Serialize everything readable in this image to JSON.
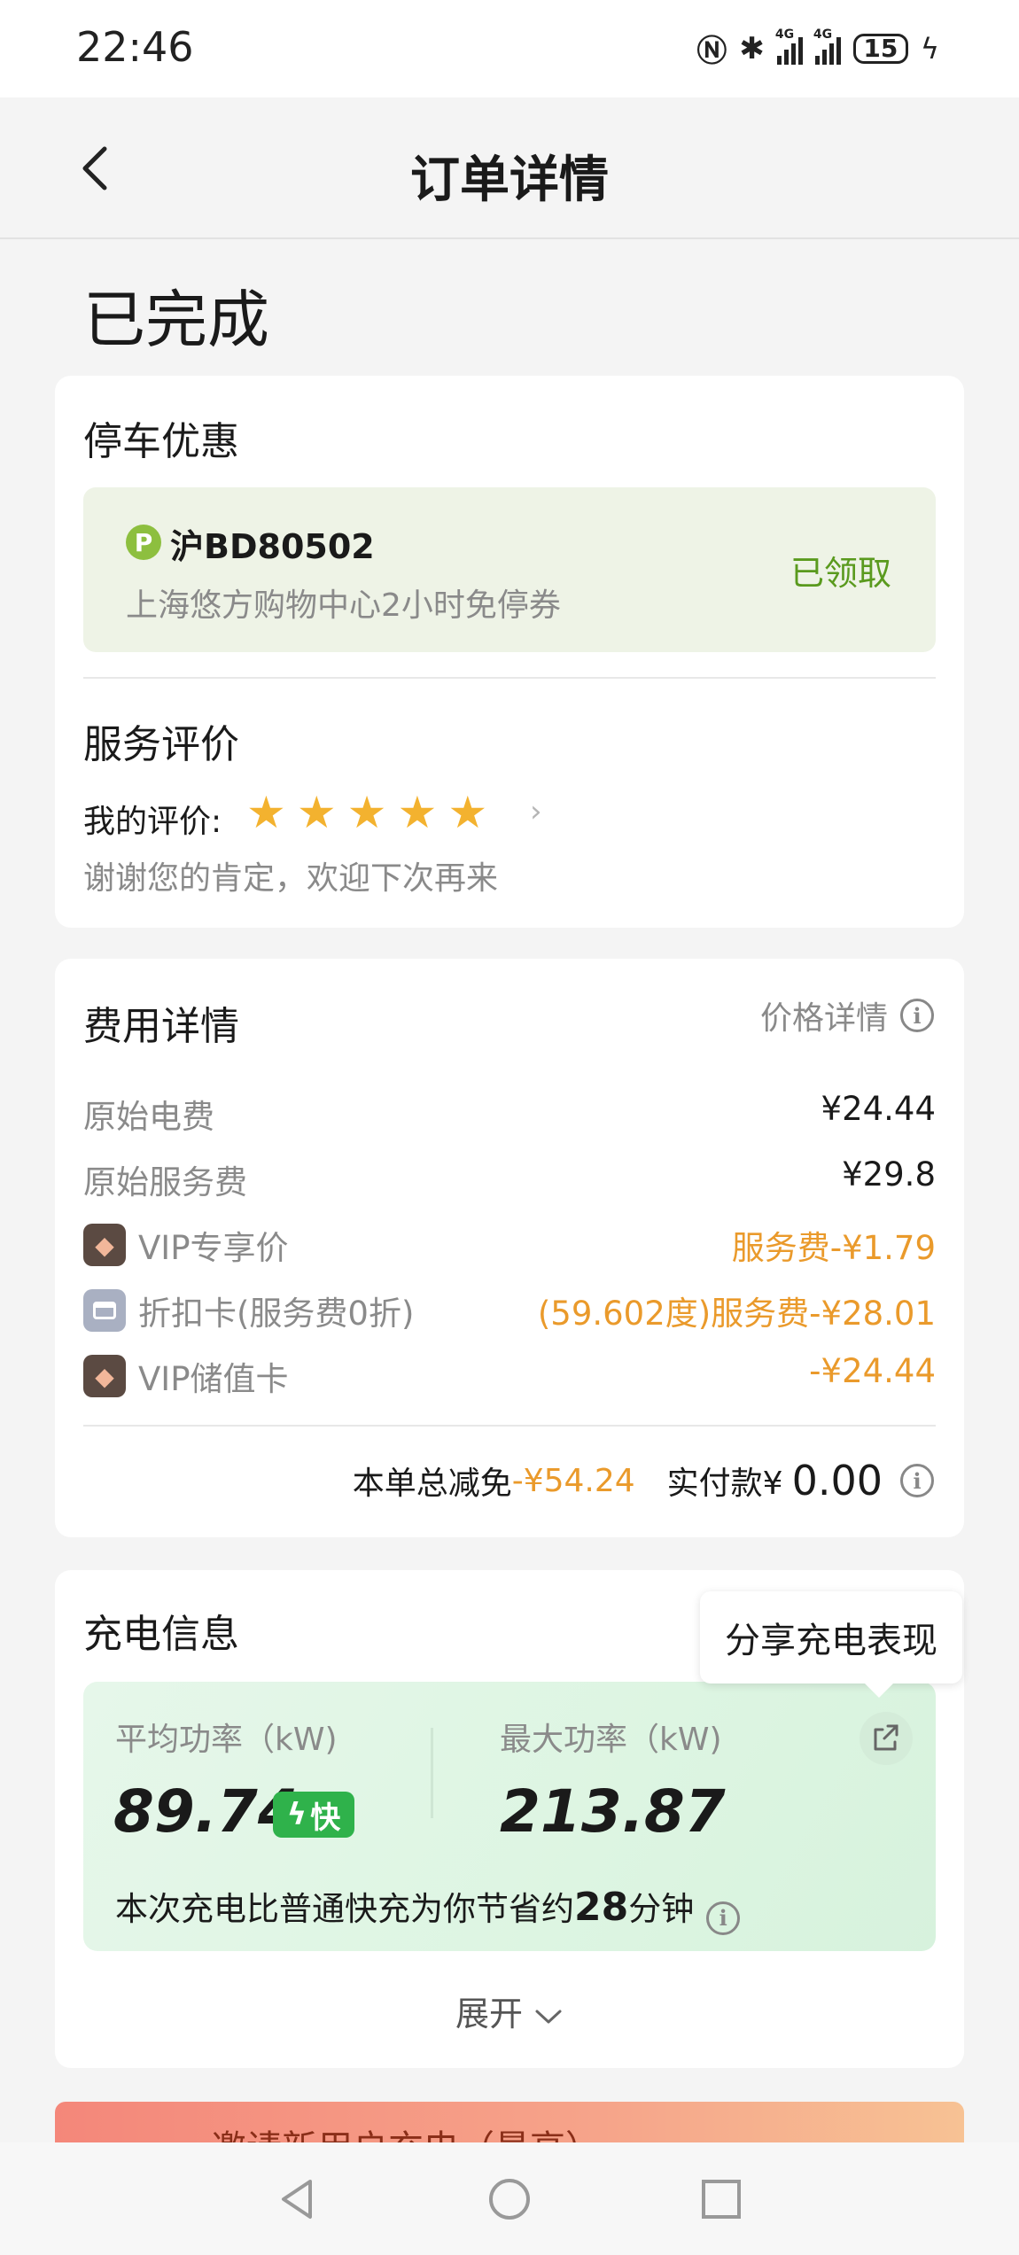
{
  "status_bar": {
    "time": "22:46",
    "icons": [
      "nfc-icon",
      "bluetooth-icon",
      "signal-4g-icon",
      "signal-4g-icon",
      "battery-icon",
      "charging-icon"
    ],
    "network_1": "4G",
    "network_2": "4G",
    "battery": "15"
  },
  "header": {
    "title": "订单详情",
    "back_icon": "chevron-left-icon"
  },
  "order_status": "已完成",
  "parking": {
    "title": "停车优惠",
    "p_badge": "P",
    "plate": "沪BD80502",
    "coupon_desc": "上海悠方购物中心2小时免停券",
    "status": "已领取"
  },
  "review": {
    "title": "服务评价",
    "my_rating_label": "我的评价:",
    "stars": 5,
    "arrow": "›",
    "comment": "谢谢您的肯定，欢迎下次再来"
  },
  "fees": {
    "title": "费用详情",
    "price_detail_link": "价格详情",
    "rows": [
      {
        "label": "原始电费",
        "value": "¥24.44"
      },
      {
        "label": "原始服务费",
        "value": "¥29.8"
      },
      {
        "label": "VIP专享价",
        "value": "服务费-¥1.79"
      },
      {
        "label": "折扣卡(服务费0折)",
        "value": "(59.602度)服务费-¥28.01"
      },
      {
        "label": "VIP储值卡",
        "value": "-¥24.44"
      }
    ],
    "total_label": "本单总减免",
    "total_discount": "-¥54.24",
    "paid_label": "实付款¥",
    "paid_amount": "0.00"
  },
  "charging": {
    "title": "充电信息",
    "share_tip": "分享充电表现",
    "avg_label": "平均功率（kW)",
    "avg_value": "89.74",
    "fast_badge": "快",
    "max_label": "最大功率（kW)",
    "max_value": "213.87",
    "saving_prefix": "本次充电比普通快充为你节省约",
    "saving_minutes": "28",
    "saving_suffix": "分钟",
    "expand_label": "展开"
  },
  "banner": {
    "text": "邀请新用户充电（最高）"
  },
  "colors": {
    "accent_orange": "#ea9a2b",
    "accent_green": "#5a9a1e",
    "fast_green": "#2fb24b",
    "star_yellow": "#f3b22f"
  }
}
